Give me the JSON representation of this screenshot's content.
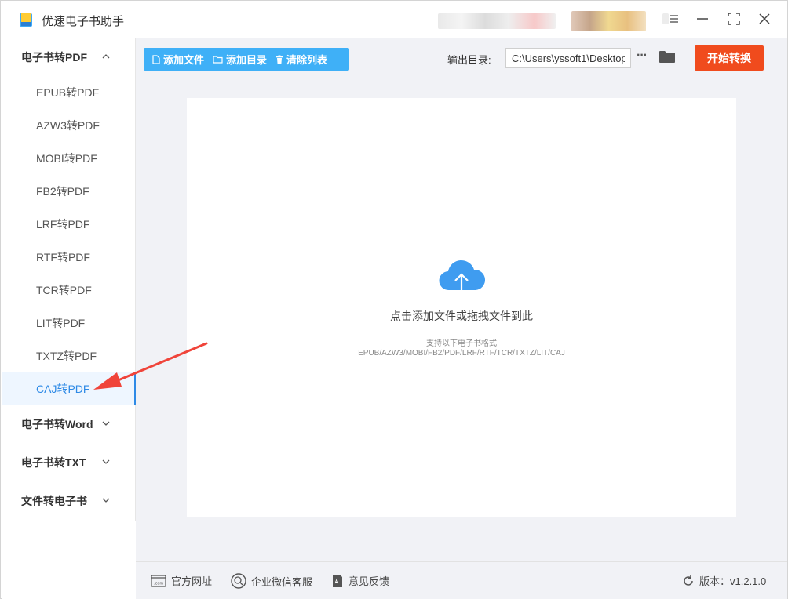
{
  "app": {
    "title": "优速电子书助手"
  },
  "sidebar": {
    "groups": [
      {
        "label": "电子书转PDF",
        "expanded": true,
        "items": [
          {
            "label": "EPUB转PDF"
          },
          {
            "label": "AZW3转PDF"
          },
          {
            "label": "MOBI转PDF"
          },
          {
            "label": "FB2转PDF"
          },
          {
            "label": "LRF转PDF"
          },
          {
            "label": "RTF转PDF"
          },
          {
            "label": "TCR转PDF"
          },
          {
            "label": "LIT转PDF"
          },
          {
            "label": "TXTZ转PDF"
          },
          {
            "label": "CAJ转PDF",
            "active": true
          }
        ]
      },
      {
        "label": "电子书转Word",
        "expanded": false
      },
      {
        "label": "电子书转TXT",
        "expanded": false
      },
      {
        "label": "文件转电子书",
        "expanded": false
      }
    ]
  },
  "toolbar": {
    "add_file": "添加文件",
    "add_dir": "添加目录",
    "clear_list": "清除列表",
    "output_label": "输出目录:",
    "output_path": "C:\\Users\\yssoft1\\Desktop",
    "start": "开始转换"
  },
  "dropzone": {
    "title": "点击添加文件或拖拽文件到此",
    "subtitle": "支持以下电子书格式",
    "formats": "EPUB/AZW3/MOBI/FB2/PDF/LRF/RTF/TCR/TXTZ/LIT/CAJ"
  },
  "footer": {
    "website": "官方网址",
    "wechat": "企业微信客服",
    "feedback": "意见反馈",
    "version": "版本：v1.2.1.0"
  },
  "colors": {
    "accent": "#3fb0f7",
    "start_button": "#f04b1d",
    "active_item": "#2e8ae6",
    "annotation_arrow": "#f0443a"
  }
}
